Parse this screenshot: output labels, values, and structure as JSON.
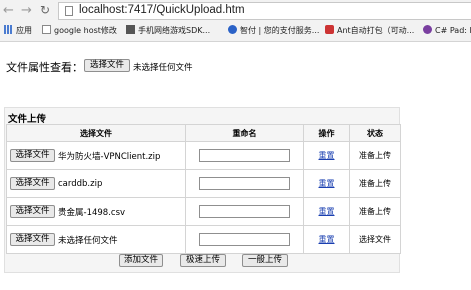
{
  "browser": {
    "url": "localhost:7417/QuickUpload.htm",
    "bookmarks": [
      "应用",
      "google host修改",
      "手机网络游戏SDK...",
      "智付 | 您的支付服务...",
      "Ant自动打包（可动...",
      "C# Pad: R"
    ]
  },
  "page": {
    "prop_label": "文件属性查看：",
    "choose_file_label": "选择文件",
    "no_file_text": "未选择任何文件"
  },
  "upload": {
    "title": "文件上传",
    "headers": [
      "选择文件",
      "重命名",
      "操作",
      "状态"
    ],
    "rows": [
      {
        "button": "选择文件",
        "filename": "华为防火墙-VPNClient.zip",
        "rename": "",
        "action": "重置",
        "status": "准备上传"
      },
      {
        "button": "选择文件",
        "filename": "carddb.zip",
        "rename": "",
        "action": "重置",
        "status": "准备上传"
      },
      {
        "button": "选择文件",
        "filename": "贵金属-1498.csv",
        "rename": "",
        "action": "重置",
        "status": "准备上传"
      },
      {
        "button": "选择文件",
        "filename": "未选择任何文件",
        "rename": "",
        "action": "重置",
        "status": "选择文件"
      }
    ],
    "buttons": {
      "add": "添加文件",
      "fast": "极速上传",
      "normal": "一般上传"
    }
  }
}
